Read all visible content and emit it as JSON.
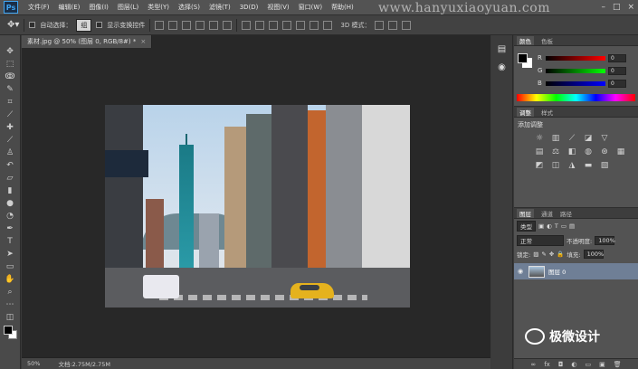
{
  "menu": {
    "logo": "Ps",
    "items": [
      "文件(F)",
      "编辑(E)",
      "图像(I)",
      "图层(L)",
      "类型(Y)",
      "选择(S)",
      "滤镜(T)",
      "3D(D)",
      "视图(V)",
      "窗口(W)",
      "帮助(H)"
    ],
    "watermark": "www.hanyuxiaoyuan.com",
    "window_controls": [
      "–",
      "□",
      "×"
    ]
  },
  "options": {
    "auto_select_label": "自动选择：",
    "auto_select_value": "组",
    "show_transform_label": "显示变换控件",
    "mode_3d_label": "3D 模式："
  },
  "document": {
    "tab_title": "素材.jpg @ 50% (图层 0, RGB/8#) *",
    "tab_close": "×",
    "zoom": "50%",
    "doc_size": "文档:2.75M/2.75M"
  },
  "color_panel": {
    "tabs": [
      "颜色",
      "色板"
    ],
    "sliders": [
      {
        "label": "R",
        "value": "0",
        "gradient": "linear-gradient(90deg, #000, #f00)"
      },
      {
        "label": "G",
        "value": "0",
        "gradient": "linear-gradient(90deg, #000, #0f0)"
      },
      {
        "label": "B",
        "value": "0",
        "gradient": "linear-gradient(90deg, #000, #00f)"
      }
    ]
  },
  "adjustments_panel": {
    "tabs": [
      "调整",
      "样式"
    ],
    "title": "添加调整"
  },
  "layers_panel": {
    "tabs": [
      "图层",
      "通道",
      "路径"
    ],
    "filter_label": "类型",
    "blend_mode": "正常",
    "opacity_label": "不透明度:",
    "opacity_value": "100%",
    "lock_label": "锁定:",
    "fill_label": "填充:",
    "fill_value": "100%",
    "layers": [
      {
        "name": "图层 0"
      }
    ],
    "bottom_icons": [
      "∞",
      "fx",
      "◘",
      "◐",
      "▭",
      "▣",
      "🗑"
    ]
  },
  "branding": {
    "text": "极微设计"
  }
}
